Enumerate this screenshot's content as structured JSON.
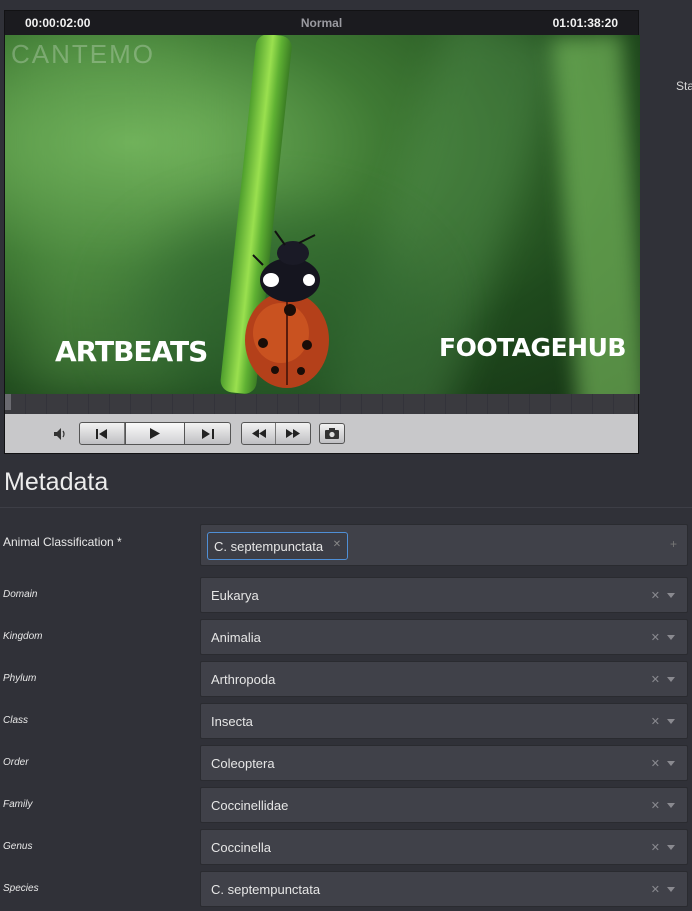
{
  "player": {
    "time_current": "00:00:02:00",
    "mode": "Normal",
    "time_total": "01:01:38:20",
    "watermark": "CANTEMO",
    "logo_left": "ARTBEATS",
    "logo_right": "FOOTAGEHUB"
  },
  "side_label": "Sta",
  "metadata": {
    "title": "Metadata",
    "animal_classification": {
      "label": "Animal Classification *",
      "tag": "C. septempunctata"
    },
    "rows": [
      {
        "label": "Domain",
        "value": "Eukarya"
      },
      {
        "label": "Kingdom",
        "value": "Animalia"
      },
      {
        "label": "Phylum",
        "value": "Arthropoda"
      },
      {
        "label": "Class",
        "value": "Insecta"
      },
      {
        "label": "Order",
        "value": "Coleoptera"
      },
      {
        "label": "Family",
        "value": "Coccinellidae"
      },
      {
        "label": "Genus",
        "value": "Coccinella"
      },
      {
        "label": "Species",
        "value": "C. septempunctata"
      }
    ]
  },
  "icons": {
    "volume": "volume-icon",
    "prev": "skip-back-icon",
    "play": "play-icon",
    "next": "skip-forward-icon",
    "rewind": "rewind-icon",
    "fast_forward": "fast-forward-icon",
    "snapshot": "camera-icon"
  }
}
